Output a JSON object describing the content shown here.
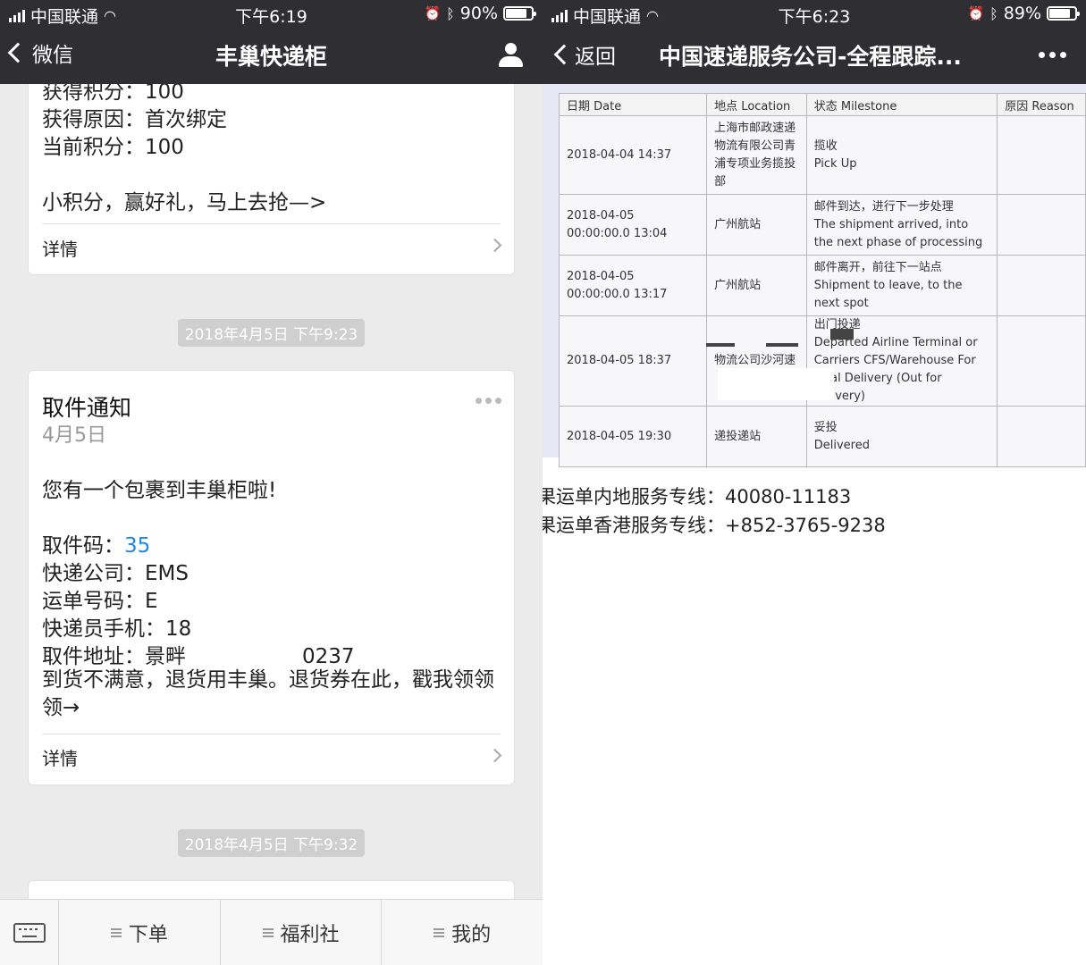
{
  "left": {
    "status": {
      "carrier": "中国联通",
      "time": "下午6:19",
      "battery": "90%",
      "battery_level": 0.9
    },
    "nav": {
      "back_label": "微信",
      "title": "丰巢快递柜"
    },
    "card1": {
      "lines": [
        "获得积分：100",
        "获得原因：首次绑定",
        "当前积分：100"
      ],
      "promo": "小积分，赢好礼，马上去抢—>",
      "detail": "详情"
    },
    "timestamp1": "2018年4月5日 下午9:23",
    "card2": {
      "title": "取件通知",
      "date": "4月5日",
      "message": "您有一个包裹到丰巢柜啦!",
      "code_label": "取件码：",
      "code_value": "35",
      "company_label": "快递公司：",
      "company_value": "EMS",
      "tracking_label": "运单号码：",
      "tracking_value": "E",
      "courier_label": "快递员手机：",
      "courier_value": "18",
      "address_label": "取件地址：",
      "address_value": "景畔",
      "address_tail": "0237",
      "notice": "到货不满意，退货用丰巢。退货券在此，戳我领领领→",
      "detail": "详情"
    },
    "timestamp2": "2018年4月5日 下午9:32",
    "tabbar": {
      "tabs": [
        "下单",
        "福利社",
        "我的"
      ]
    }
  },
  "right": {
    "status": {
      "carrier": "中国联通",
      "time": "下午6:23",
      "battery": "89%",
      "battery_level": 0.89
    },
    "nav": {
      "back_label": "返回",
      "title": "中国速递服务公司-全程跟踪..."
    },
    "table": {
      "headers": [
        "日期 Date",
        "地点 Location",
        "状态 Milestone",
        "原因 Reason"
      ],
      "rows": [
        {
          "date": "2018-04-04 14:37",
          "location": "上海市邮政速递物流有限公司青浦专项业务揽投部",
          "ms_cn": "揽收",
          "ms_en": "Pick Up",
          "reason": ""
        },
        {
          "date": "2018-04-05 00:00:00.0 13:04",
          "location": "广州航站",
          "ms_cn": "邮件到达，进行下一步处理",
          "ms_en": "The shipment arrived, into the next phase of processing",
          "reason": ""
        },
        {
          "date": "2018-04-05 00:00:00.0 13:17",
          "location": "广州航站",
          "ms_cn": "邮件离开，前往下一站点",
          "ms_en": "Shipment to leave, to the next spot",
          "reason": ""
        },
        {
          "date": "2018-04-05 18:37",
          "location": "物流公司沙河速",
          "ms_cn": "出门投递",
          "ms_en": "Departed Airline Terminal or Carriers CFS/Warehouse For Final Delivery (Out for delivery)",
          "reason": ""
        },
        {
          "date": "2018-04-05 19:30",
          "location": "递投递站",
          "ms_cn": "妥投",
          "ms_en": "Delivered",
          "reason": ""
        }
      ]
    },
    "hotline1": "果运单内地服务专线：40080-11183",
    "hotline2": "果运单香港服务专线：+852-3765-9238"
  }
}
